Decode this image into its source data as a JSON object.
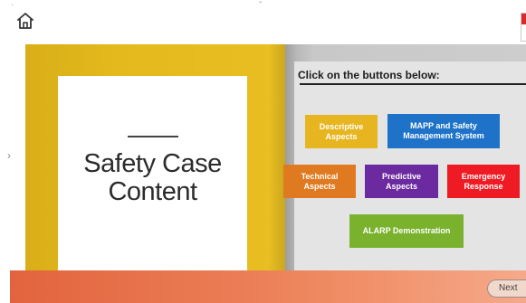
{
  "header": {
    "home_icon": "home-icon",
    "tick_top_left": "·",
    "tick_top_center": "ˇ",
    "side_arrow": "›"
  },
  "book": {
    "cover_title": "Safety Case Content",
    "instruction": "Click on the buttons below:"
  },
  "buttons": {
    "descriptive": "Descriptive Aspects",
    "mapp": "MAPP and Safety Management System",
    "technical": "Technical Aspects",
    "predictive": "Predictive Aspects",
    "emergency": "Emergency Response",
    "alarp": "ALARP Demonstration"
  },
  "footer": {
    "next_label": "Next"
  },
  "colors": {
    "descriptive": "#e6b51f",
    "mapp": "#1e73c8",
    "technical": "#e07a20",
    "predictive": "#6b2aa0",
    "emergency": "#ee1b24",
    "alarp": "#7ab22e",
    "cover": "#e3b91d",
    "footer": "#eb7d55"
  }
}
